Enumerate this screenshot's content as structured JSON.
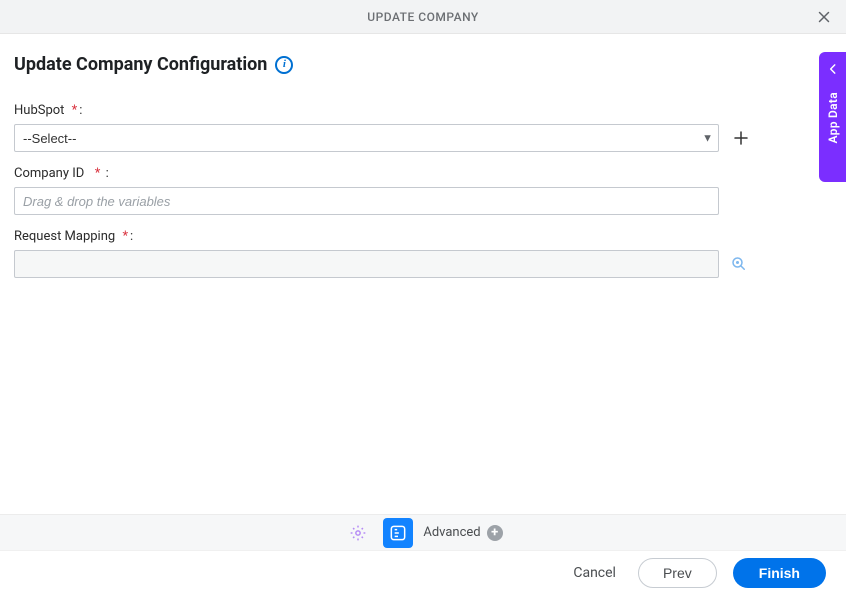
{
  "header": {
    "title": "UPDATE COMPANY"
  },
  "page": {
    "title": "Update Company Configuration",
    "info_icon": "info-icon"
  },
  "sidebar_tab": {
    "label": "App Data"
  },
  "fields": {
    "hubspot": {
      "label": "HubSpot",
      "placeholder": "--Select--",
      "value": "--Select--"
    },
    "company_id": {
      "label": "Company ID",
      "placeholder": "Drag & drop the variables",
      "value": ""
    },
    "request_mapping": {
      "label": "Request Mapping",
      "value": ""
    }
  },
  "toolbar": {
    "advanced_label": "Advanced"
  },
  "buttons": {
    "cancel": "Cancel",
    "prev": "Prev",
    "finish": "Finish"
  }
}
